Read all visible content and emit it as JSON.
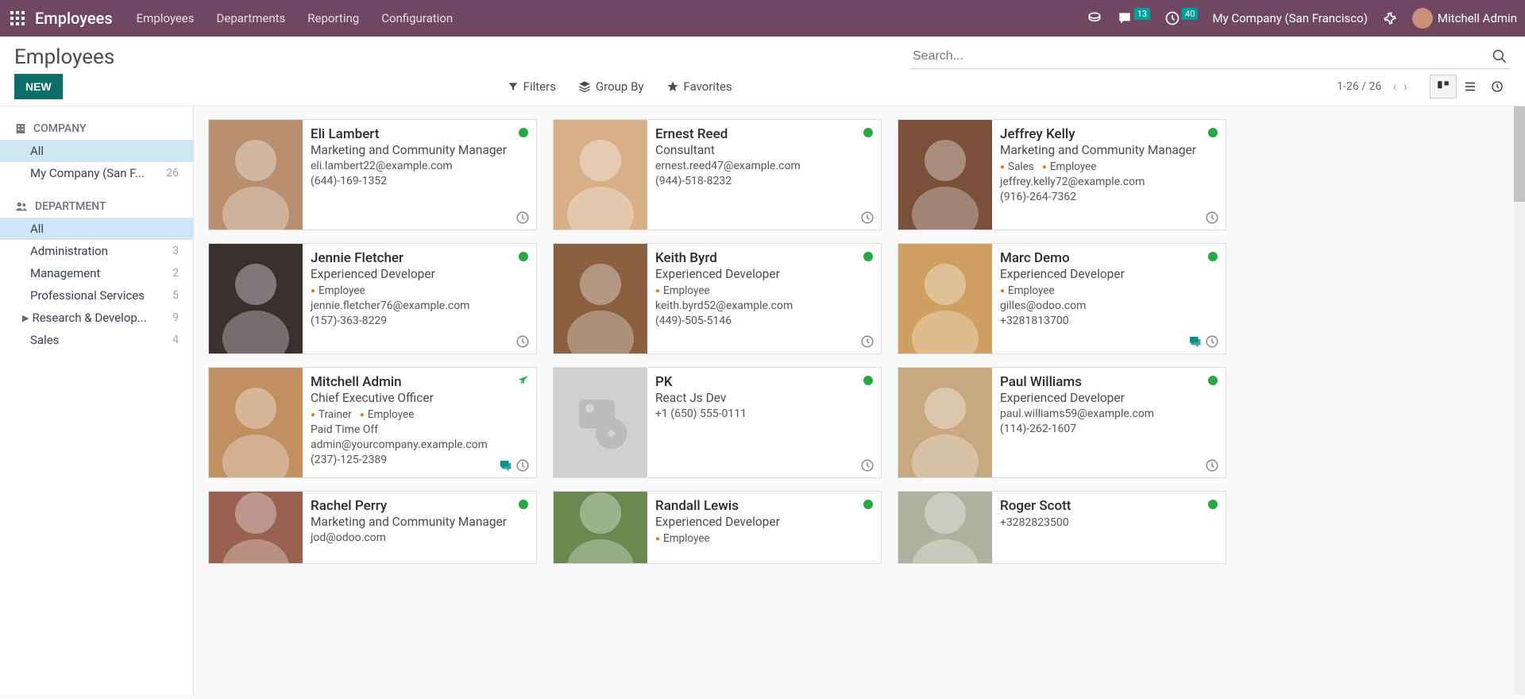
{
  "topbar": {
    "brand": "Employees",
    "menu": [
      "Employees",
      "Departments",
      "Reporting",
      "Configuration"
    ],
    "chat_badge": "13",
    "clock_badge": "40",
    "company": "My Company (San Francisco)",
    "user": "Mitchell Admin"
  },
  "subhead": {
    "title": "Employees",
    "search_placeholder": "Search...",
    "new_btn": "NEW",
    "filters": "Filters",
    "groupby": "Group By",
    "favorites": "Favorites",
    "pager": "1-26 / 26"
  },
  "sidebar": {
    "company_section": "COMPANY",
    "company_items": [
      {
        "label": "All",
        "count": "",
        "active": true
      },
      {
        "label": "My Company (San F...",
        "count": "26"
      }
    ],
    "dept_section": "DEPARTMENT",
    "dept_items": [
      {
        "label": "All",
        "count": "",
        "active": true
      },
      {
        "label": "Administration",
        "count": "3"
      },
      {
        "label": "Management",
        "count": "2"
      },
      {
        "label": "Professional Services",
        "count": "5"
      },
      {
        "label": "Research & Develop...",
        "count": "9",
        "caret": true
      },
      {
        "label": "Sales",
        "count": "4"
      }
    ]
  },
  "employees": [
    {
      "name": "Eli Lambert",
      "title": "Marketing and Community Manager",
      "tags": [],
      "email": "eli.lambert22@example.com",
      "phone": "(644)-169-1352",
      "status": "dot",
      "clock": true,
      "photo": "m1"
    },
    {
      "name": "Ernest Reed",
      "title": "Consultant",
      "tags": [],
      "email": "ernest.reed47@example.com",
      "phone": "(944)-518-8232",
      "status": "dot",
      "clock": true,
      "photo": "m2"
    },
    {
      "name": "Jeffrey Kelly",
      "title": "Marketing and Community Manager",
      "tags": [
        "Sales",
        "Employee"
      ],
      "email": "jeffrey.kelly72@example.com",
      "phone": "(916)-264-7362",
      "status": "dot",
      "clock": true,
      "photo": "m3"
    },
    {
      "name": "Jennie Fletcher",
      "title": "Experienced Developer",
      "tags": [
        "Employee"
      ],
      "email": "jennie.fletcher76@example.com",
      "phone": "(157)-363-8229",
      "status": "dot",
      "clock": true,
      "photo": "f1"
    },
    {
      "name": "Keith Byrd",
      "title": "Experienced Developer",
      "tags": [
        "Employee"
      ],
      "email": "keith.byrd52@example.com",
      "phone": "(449)-505-5146",
      "status": "dot",
      "clock": true,
      "photo": "m4"
    },
    {
      "name": "Marc Demo",
      "title": "Experienced Developer",
      "tags": [
        "Employee"
      ],
      "email": "gilles@odoo.com",
      "phone": "+3281813700",
      "status": "dot",
      "clock": true,
      "chat": true,
      "photo": "m5"
    },
    {
      "name": "Mitchell Admin",
      "title": "Chief Executive Officer",
      "tags": [
        "Trainer",
        "Employee"
      ],
      "extra": "Paid Time Off",
      "email": "admin@yourcompany.example.com",
      "phone": "(237)-125-2389",
      "status": "plane",
      "clock": true,
      "chat": true,
      "photo": "m6"
    },
    {
      "name": "PK",
      "title": "React Js Dev",
      "tags": [],
      "email": "",
      "phone": "+1 (650) 555-0111",
      "status": "dot",
      "clock": true,
      "photo": "placeholder"
    },
    {
      "name": "Paul Williams",
      "title": "Experienced Developer",
      "tags": [],
      "email": "paul.williams59@example.com",
      "phone": "(114)-262-1607",
      "status": "dot",
      "clock": true,
      "photo": "m7"
    },
    {
      "name": "Rachel Perry",
      "title": "Marketing and Community Manager",
      "tags": [],
      "email": "jod@odoo.com",
      "phone": "",
      "status": "dot",
      "photo": "f2",
      "short": true
    },
    {
      "name": "Randall Lewis",
      "title": "Experienced Developer",
      "tags": [
        "Employee"
      ],
      "email": "",
      "phone": "",
      "status": "dot",
      "photo": "m8",
      "short": true
    },
    {
      "name": "Roger Scott",
      "title": "",
      "tags": [],
      "email": "",
      "phone": "+3282823500",
      "status": "dot",
      "photo": "m9",
      "short": true
    }
  ]
}
